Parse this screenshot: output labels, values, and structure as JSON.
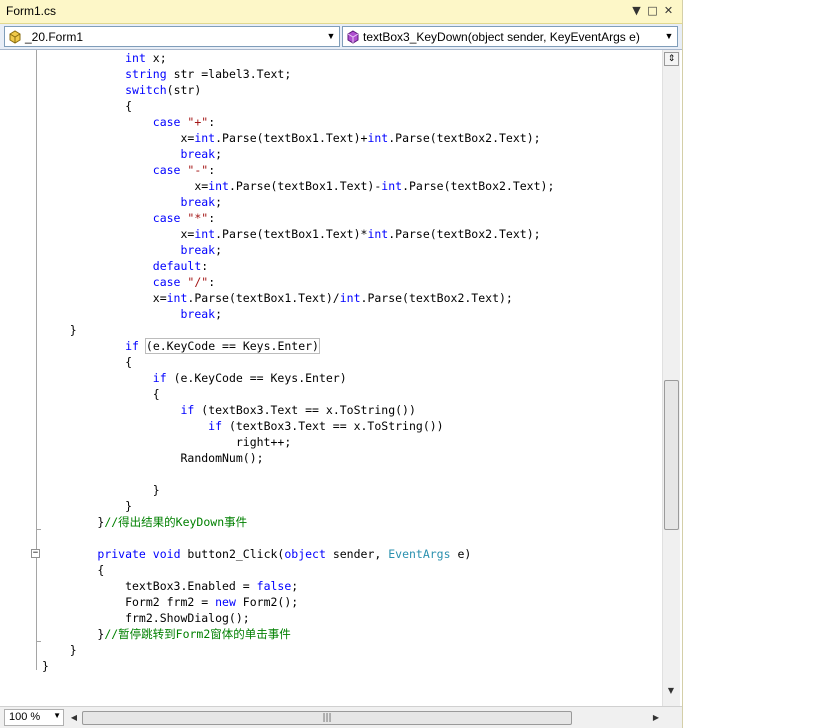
{
  "window": {
    "title": "Form1.cs",
    "controls": {
      "dropdown": "▼",
      "maximize": "□",
      "close": "✕"
    }
  },
  "navbar": {
    "type_combo": "_20.Form1",
    "member_combo": "textBox3_KeyDown(object sender, KeyEventArgs e)",
    "arrow": "▼"
  },
  "code_lines": [
    [
      {
        "t": "            "
      },
      {
        "t": "int",
        "c": "kw"
      },
      {
        "t": " x;"
      }
    ],
    [
      {
        "t": "            "
      },
      {
        "t": "string",
        "c": "kw"
      },
      {
        "t": " str =label3.Text;"
      }
    ],
    [
      {
        "t": "            "
      },
      {
        "t": "switch",
        "c": "kw"
      },
      {
        "t": "(str)"
      }
    ],
    [
      {
        "t": "            {"
      }
    ],
    [
      {
        "t": "                "
      },
      {
        "t": "case",
        "c": "kw"
      },
      {
        "t": " "
      },
      {
        "t": "\"+\"",
        "c": "str"
      },
      {
        "t": ":"
      }
    ],
    [
      {
        "t": "                    x="
      },
      {
        "t": "int",
        "c": "kw"
      },
      {
        "t": ".Parse(textBox1.Text)+"
      },
      {
        "t": "int",
        "c": "kw"
      },
      {
        "t": ".Parse(textBox2.Text);"
      }
    ],
    [
      {
        "t": "                    "
      },
      {
        "t": "break",
        "c": "kw"
      },
      {
        "t": ";"
      }
    ],
    [
      {
        "t": "                "
      },
      {
        "t": "case",
        "c": "kw"
      },
      {
        "t": " "
      },
      {
        "t": "\"-\"",
        "c": "str"
      },
      {
        "t": ":"
      }
    ],
    [
      {
        "t": "                      x="
      },
      {
        "t": "int",
        "c": "kw"
      },
      {
        "t": ".Parse(textBox1.Text)-"
      },
      {
        "t": "int",
        "c": "kw"
      },
      {
        "t": ".Parse(textBox2.Text);"
      }
    ],
    [
      {
        "t": "                    "
      },
      {
        "t": "break",
        "c": "kw"
      },
      {
        "t": ";"
      }
    ],
    [
      {
        "t": "                "
      },
      {
        "t": "case",
        "c": "kw"
      },
      {
        "t": " "
      },
      {
        "t": "\"*\"",
        "c": "str"
      },
      {
        "t": ":"
      }
    ],
    [
      {
        "t": "                    x="
      },
      {
        "t": "int",
        "c": "kw"
      },
      {
        "t": ".Parse(textBox1.Text)*"
      },
      {
        "t": "int",
        "c": "kw"
      },
      {
        "t": ".Parse(textBox2.Text);"
      }
    ],
    [
      {
        "t": "                    "
      },
      {
        "t": "break",
        "c": "kw"
      },
      {
        "t": ";"
      }
    ],
    [
      {
        "t": "                "
      },
      {
        "t": "default",
        "c": "kw"
      },
      {
        "t": ":"
      }
    ],
    [
      {
        "t": "                "
      },
      {
        "t": "case",
        "c": "kw"
      },
      {
        "t": " "
      },
      {
        "t": "\"/\"",
        "c": "str"
      },
      {
        "t": ":"
      }
    ],
    [
      {
        "t": "                x="
      },
      {
        "t": "int",
        "c": "kw"
      },
      {
        "t": ".Parse(textBox1.Text)/"
      },
      {
        "t": "int",
        "c": "kw"
      },
      {
        "t": ".Parse(textBox2.Text);"
      }
    ],
    [
      {
        "t": "                    "
      },
      {
        "t": "break",
        "c": "kw"
      },
      {
        "t": ";"
      }
    ],
    [
      {
        "t": "    }"
      }
    ],
    [
      {
        "t": "            "
      },
      {
        "t": "if",
        "c": "kw"
      },
      {
        "t": " "
      },
      {
        "t": "(e.KeyCode == Keys.Enter)",
        "c": "hl"
      }
    ],
    [
      {
        "t": "            {"
      }
    ],
    [
      {
        "t": "                "
      },
      {
        "t": "if",
        "c": "kw"
      },
      {
        "t": " (e.KeyCode == Keys.Enter)"
      }
    ],
    [
      {
        "t": "                {"
      }
    ],
    [
      {
        "t": "                    "
      },
      {
        "t": "if",
        "c": "kw"
      },
      {
        "t": " (textBox3.Text == x.ToString())"
      }
    ],
    [
      {
        "t": "                        "
      },
      {
        "t": "if",
        "c": "kw"
      },
      {
        "t": " (textBox3.Text == x.ToString())"
      }
    ],
    [
      {
        "t": "                            right++;"
      }
    ],
    [
      {
        "t": "                    RandomNum();"
      }
    ],
    [
      {
        "t": ""
      }
    ],
    [
      {
        "t": "                }"
      }
    ],
    [
      {
        "t": "            }"
      }
    ],
    [
      {
        "t": "        }"
      },
      {
        "t": "//得出结果的KeyDown事件",
        "c": "cm"
      }
    ],
    [
      {
        "t": ""
      }
    ],
    [
      {
        "t": "        "
      },
      {
        "t": "private",
        "c": "kw"
      },
      {
        "t": " "
      },
      {
        "t": "void",
        "c": "kw"
      },
      {
        "t": " button2_Click("
      },
      {
        "t": "object",
        "c": "kw"
      },
      {
        "t": " sender, "
      },
      {
        "t": "EventArgs",
        "c": "ty"
      },
      {
        "t": " e)"
      }
    ],
    [
      {
        "t": "        {"
      }
    ],
    [
      {
        "t": "            textBox3.Enabled = "
      },
      {
        "t": "false",
        "c": "kw"
      },
      {
        "t": ";"
      }
    ],
    [
      {
        "t": "            Form2 frm2 = "
      },
      {
        "t": "new",
        "c": "kw"
      },
      {
        "t": " Form2();"
      }
    ],
    [
      {
        "t": "            frm2.ShowDialog();"
      }
    ],
    [
      {
        "t": "        }"
      },
      {
        "t": "//暂停跳转到Form2窗体的单击事件",
        "c": "cm"
      }
    ],
    [
      {
        "t": "    }"
      }
    ],
    [
      {
        "t": "}"
      }
    ]
  ],
  "statusbar": {
    "zoom": "100 %",
    "arrow": "▼"
  },
  "colors": {
    "keyword": "#0000ff",
    "string": "#a31515",
    "type": "#2b91af",
    "comment": "#008000",
    "titlebar": "#fdf7c8"
  }
}
